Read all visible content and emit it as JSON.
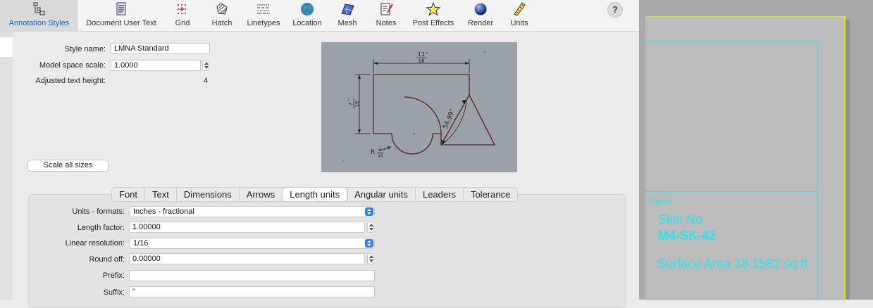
{
  "toolbar": {
    "items": [
      {
        "label": "Annotation Styles",
        "icon": "annotation-styles-icon",
        "active": true
      },
      {
        "label": "Document User Text",
        "icon": "document-user-text-icon"
      },
      {
        "label": "Grid",
        "icon": "grid-icon"
      },
      {
        "label": "Hatch",
        "icon": "hatch-icon"
      },
      {
        "label": "Linetypes",
        "icon": "linetypes-icon"
      },
      {
        "label": "Location",
        "icon": "globe-icon"
      },
      {
        "label": "Mesh",
        "icon": "mesh-icon"
      },
      {
        "label": "Notes",
        "icon": "notes-icon"
      },
      {
        "label": "Post Effects",
        "icon": "star-icon"
      },
      {
        "label": "Render",
        "icon": "render-sphere-icon"
      },
      {
        "label": "Units",
        "icon": "ruler-icon"
      }
    ],
    "help": "?"
  },
  "style": {
    "name_label": "Style name:",
    "name_value": "LMNA Standard",
    "scale_label": "Model space scale:",
    "scale_value": "1.0000",
    "height_label": "Adjusted text height:",
    "height_value": "4",
    "scale_all": "Scale all sizes"
  },
  "preview": {
    "dim_top_num": "11",
    "dim_top_den": "16",
    "dim_left_num": "7",
    "dim_left_den": "16",
    "angle": "54.99°",
    "radius_prefix": "R",
    "radius_num": "3",
    "radius_den": "16",
    "unit_mark": "\""
  },
  "tabs": [
    "Font",
    "Text",
    "Dimensions",
    "Arrows",
    "Length units",
    "Angular units",
    "Leaders",
    "Tolerance"
  ],
  "active_tab": "Length units",
  "length_units": {
    "formats_label": "Units - formats:",
    "formats_value": "Inches - fractional",
    "factor_label": "Length factor:",
    "factor_value": "1.00000",
    "resolution_label": "Linear resolution:",
    "resolution_value": "1/16",
    "roundoff_label": "Round off:",
    "roundoff_value": "0.00000",
    "prefix_label": "Prefix:",
    "prefix_value": "",
    "suffix_label": "Suffix:",
    "suffix_value": "\""
  },
  "viewport": {
    "legend": "Legend:",
    "skin_label": "Skin No.",
    "skin_value": "M4-SK-42",
    "surface": "Surface Area 18.1582 sq ft"
  },
  "colors": {
    "accent": "#1c63c9",
    "select": "#2f7bf5",
    "cyan": "#27e3f0",
    "preview_bg": "#9ba1a8",
    "shape": "#5a1f1f"
  }
}
